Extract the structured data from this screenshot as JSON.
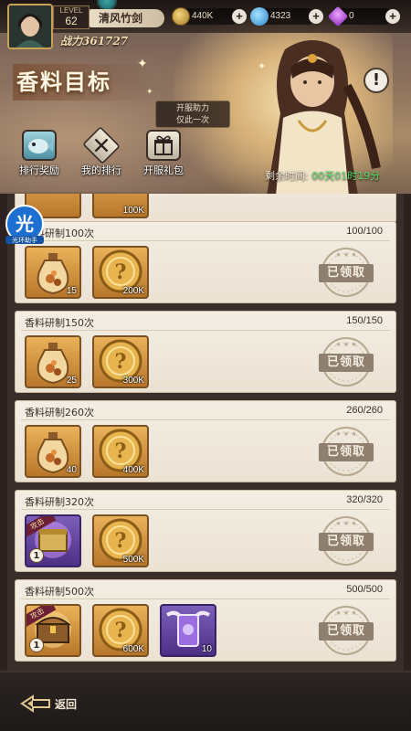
{
  "player": {
    "level_label": "LEVEL",
    "level": "62",
    "name": "清风竹剑",
    "power": "战力361727"
  },
  "resources": {
    "gold": "440K",
    "gems": "4323",
    "diamonds": "0",
    "plus": "+"
  },
  "event": {
    "title": "香料目标",
    "assist_line1": "开服助力",
    "assist_line2": "仅此一次",
    "help": "!",
    "countdown_label": "剩余时间:",
    "countdown_value": "00天01时19分"
  },
  "nav": [
    {
      "label": "排行奖励",
      "icon": "fish-icon"
    },
    {
      "label": "我的排行",
      "icon": "crossed-swords-icon"
    },
    {
      "label": "开服礼包",
      "icon": "gift-icon"
    }
  ],
  "hint_badge": {
    "glyph": "光",
    "text": "光环助手"
  },
  "partial_card": {
    "count": "100K"
  },
  "rows": [
    {
      "title": "香料研制100次",
      "progress": "100/100",
      "items": [
        {
          "icon": "spice-bottle-icon",
          "count": "15",
          "kind": "bottle"
        },
        {
          "icon": "gold-coin-icon",
          "count": "200K",
          "kind": "coin"
        }
      ],
      "status": "已领取"
    },
    {
      "title": "香料研制150次",
      "progress": "150/150",
      "items": [
        {
          "icon": "spice-bottle-icon",
          "count": "25",
          "kind": "bottle"
        },
        {
          "icon": "gold-coin-icon",
          "count": "300K",
          "kind": "coin"
        }
      ],
      "status": "已领取"
    },
    {
      "title": "香料研制260次",
      "progress": "260/260",
      "items": [
        {
          "icon": "spice-bottle-icon",
          "count": "40",
          "kind": "bottle"
        },
        {
          "icon": "gold-coin-icon",
          "count": "400K",
          "kind": "coin"
        }
      ],
      "status": "已领取"
    },
    {
      "title": "香料研制320次",
      "progress": "320/320",
      "items": [
        {
          "icon": "treasure-box-icon",
          "count": "1",
          "kind": "box",
          "tag": "攻击"
        },
        {
          "icon": "gold-coin-icon",
          "count": "500K",
          "kind": "coin"
        }
      ],
      "status": "已领取"
    },
    {
      "title": "香料研制500次",
      "progress": "500/500",
      "items": [
        {
          "icon": "treasure-chest-icon",
          "count": "1",
          "kind": "chest",
          "tag": "攻击"
        },
        {
          "icon": "gold-coin-icon",
          "count": "600K",
          "kind": "coin"
        },
        {
          "icon": "winged-card-icon",
          "count": "10",
          "kind": "card"
        }
      ],
      "status": "已领取"
    }
  ],
  "footer": {
    "back_label": "返回"
  }
}
